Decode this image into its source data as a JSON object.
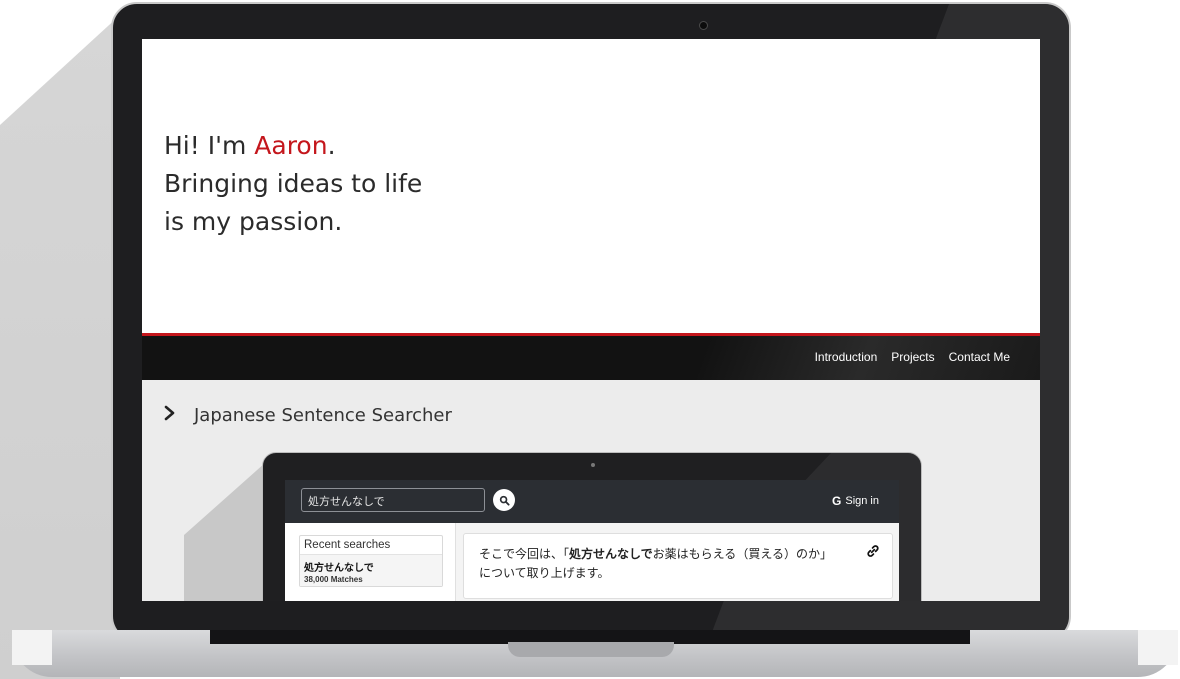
{
  "hero": {
    "greeting_prefix": "Hi! I'm ",
    "name": "Aaron",
    "greeting_suffix": ".",
    "line2": "Bringing ideas to life",
    "line3": "is my passion."
  },
  "nav": {
    "items": [
      {
        "label": "Introduction"
      },
      {
        "label": "Projects"
      },
      {
        "label": "Contact Me"
      }
    ]
  },
  "project": {
    "title": "Japanese Sentence Searcher",
    "chevron_icon": "chevron-right-icon"
  },
  "app": {
    "search_value": "処方せんなしで",
    "search_icon": "search-icon",
    "signin_label": "Sign in",
    "google_glyph": "G",
    "sidebar": {
      "heading": "Recent searches",
      "items": [
        {
          "term": "処方せんなしで",
          "count": "38,000 Matches"
        }
      ]
    },
    "result": {
      "prefix": "そこで今回は、「",
      "highlight": "処方せんなしで",
      "rest": "お薬はもらえる（買える）のか」",
      "line2": "について取り上げます。",
      "link_icon": "link-icon"
    }
  },
  "colors": {
    "accent": "#c4161c",
    "nav_bg": "#121212",
    "content_bg": "#ececec",
    "app_header_bg": "#2b2e33"
  }
}
